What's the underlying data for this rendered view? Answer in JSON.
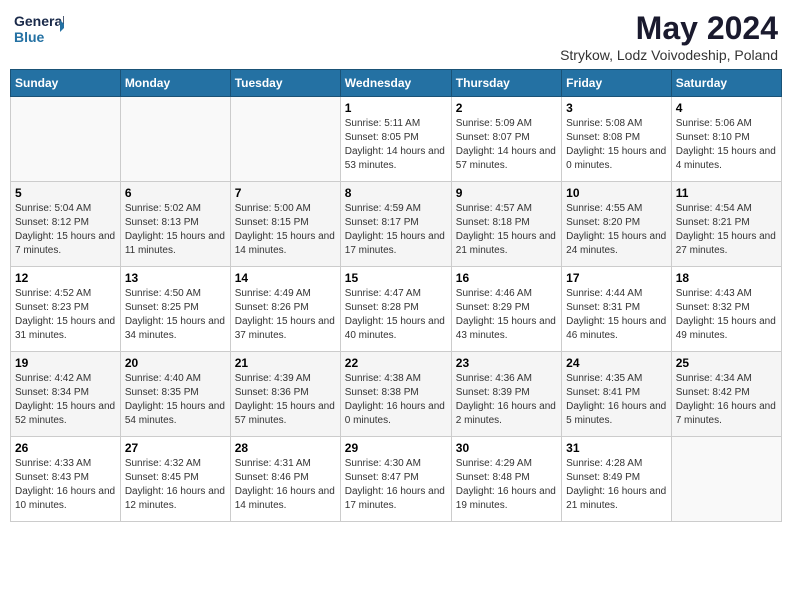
{
  "header": {
    "logo_line1": "General",
    "logo_line2": "Blue",
    "month_title": "May 2024",
    "subtitle": "Strykow, Lodz Voivodeship, Poland"
  },
  "days_of_week": [
    "Sunday",
    "Monday",
    "Tuesday",
    "Wednesday",
    "Thursday",
    "Friday",
    "Saturday"
  ],
  "weeks": [
    [
      {
        "day": "",
        "info": ""
      },
      {
        "day": "",
        "info": ""
      },
      {
        "day": "",
        "info": ""
      },
      {
        "day": "1",
        "info": "Sunrise: 5:11 AM\nSunset: 8:05 PM\nDaylight: 14 hours and 53 minutes."
      },
      {
        "day": "2",
        "info": "Sunrise: 5:09 AM\nSunset: 8:07 PM\nDaylight: 14 hours and 57 minutes."
      },
      {
        "day": "3",
        "info": "Sunrise: 5:08 AM\nSunset: 8:08 PM\nDaylight: 15 hours and 0 minutes."
      },
      {
        "day": "4",
        "info": "Sunrise: 5:06 AM\nSunset: 8:10 PM\nDaylight: 15 hours and 4 minutes."
      }
    ],
    [
      {
        "day": "5",
        "info": "Sunrise: 5:04 AM\nSunset: 8:12 PM\nDaylight: 15 hours and 7 minutes."
      },
      {
        "day": "6",
        "info": "Sunrise: 5:02 AM\nSunset: 8:13 PM\nDaylight: 15 hours and 11 minutes."
      },
      {
        "day": "7",
        "info": "Sunrise: 5:00 AM\nSunset: 8:15 PM\nDaylight: 15 hours and 14 minutes."
      },
      {
        "day": "8",
        "info": "Sunrise: 4:59 AM\nSunset: 8:17 PM\nDaylight: 15 hours and 17 minutes."
      },
      {
        "day": "9",
        "info": "Sunrise: 4:57 AM\nSunset: 8:18 PM\nDaylight: 15 hours and 21 minutes."
      },
      {
        "day": "10",
        "info": "Sunrise: 4:55 AM\nSunset: 8:20 PM\nDaylight: 15 hours and 24 minutes."
      },
      {
        "day": "11",
        "info": "Sunrise: 4:54 AM\nSunset: 8:21 PM\nDaylight: 15 hours and 27 minutes."
      }
    ],
    [
      {
        "day": "12",
        "info": "Sunrise: 4:52 AM\nSunset: 8:23 PM\nDaylight: 15 hours and 31 minutes."
      },
      {
        "day": "13",
        "info": "Sunrise: 4:50 AM\nSunset: 8:25 PM\nDaylight: 15 hours and 34 minutes."
      },
      {
        "day": "14",
        "info": "Sunrise: 4:49 AM\nSunset: 8:26 PM\nDaylight: 15 hours and 37 minutes."
      },
      {
        "day": "15",
        "info": "Sunrise: 4:47 AM\nSunset: 8:28 PM\nDaylight: 15 hours and 40 minutes."
      },
      {
        "day": "16",
        "info": "Sunrise: 4:46 AM\nSunset: 8:29 PM\nDaylight: 15 hours and 43 minutes."
      },
      {
        "day": "17",
        "info": "Sunrise: 4:44 AM\nSunset: 8:31 PM\nDaylight: 15 hours and 46 minutes."
      },
      {
        "day": "18",
        "info": "Sunrise: 4:43 AM\nSunset: 8:32 PM\nDaylight: 15 hours and 49 minutes."
      }
    ],
    [
      {
        "day": "19",
        "info": "Sunrise: 4:42 AM\nSunset: 8:34 PM\nDaylight: 15 hours and 52 minutes."
      },
      {
        "day": "20",
        "info": "Sunrise: 4:40 AM\nSunset: 8:35 PM\nDaylight: 15 hours and 54 minutes."
      },
      {
        "day": "21",
        "info": "Sunrise: 4:39 AM\nSunset: 8:36 PM\nDaylight: 15 hours and 57 minutes."
      },
      {
        "day": "22",
        "info": "Sunrise: 4:38 AM\nSunset: 8:38 PM\nDaylight: 16 hours and 0 minutes."
      },
      {
        "day": "23",
        "info": "Sunrise: 4:36 AM\nSunset: 8:39 PM\nDaylight: 16 hours and 2 minutes."
      },
      {
        "day": "24",
        "info": "Sunrise: 4:35 AM\nSunset: 8:41 PM\nDaylight: 16 hours and 5 minutes."
      },
      {
        "day": "25",
        "info": "Sunrise: 4:34 AM\nSunset: 8:42 PM\nDaylight: 16 hours and 7 minutes."
      }
    ],
    [
      {
        "day": "26",
        "info": "Sunrise: 4:33 AM\nSunset: 8:43 PM\nDaylight: 16 hours and 10 minutes."
      },
      {
        "day": "27",
        "info": "Sunrise: 4:32 AM\nSunset: 8:45 PM\nDaylight: 16 hours and 12 minutes."
      },
      {
        "day": "28",
        "info": "Sunrise: 4:31 AM\nSunset: 8:46 PM\nDaylight: 16 hours and 14 minutes."
      },
      {
        "day": "29",
        "info": "Sunrise: 4:30 AM\nSunset: 8:47 PM\nDaylight: 16 hours and 17 minutes."
      },
      {
        "day": "30",
        "info": "Sunrise: 4:29 AM\nSunset: 8:48 PM\nDaylight: 16 hours and 19 minutes."
      },
      {
        "day": "31",
        "info": "Sunrise: 4:28 AM\nSunset: 8:49 PM\nDaylight: 16 hours and 21 minutes."
      },
      {
        "day": "",
        "info": ""
      }
    ]
  ]
}
